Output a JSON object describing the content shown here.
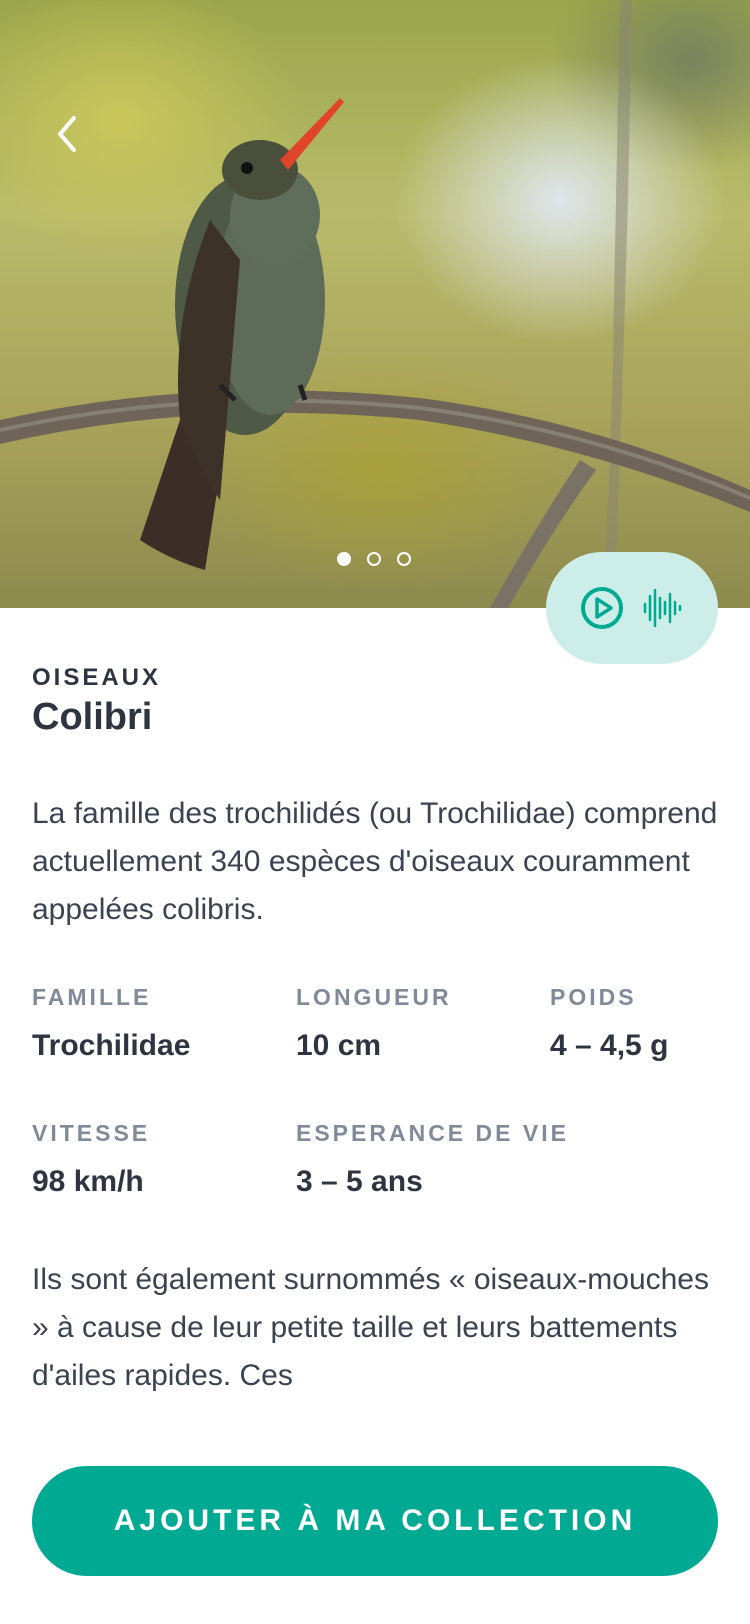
{
  "hero": {
    "photo_subject": "hummingbird-on-branch",
    "dots": [
      true,
      false,
      false
    ]
  },
  "icons": {
    "back": "chevron-left-icon",
    "play": "play-circle-icon",
    "waveform": "sound-wave-icon"
  },
  "bird": {
    "category": "OISEAUX",
    "name": "Colibri",
    "description": "La famille des trochilidés (ou Trochilidae) comprend actuellement 340 espèces d'oiseaux couramment appelées colibris.",
    "stats": [
      {
        "label": "FAMILLE",
        "value": "Trochilidae"
      },
      {
        "label": "LONGUEUR",
        "value": "10 cm"
      },
      {
        "label": "POIDS",
        "value": "4 – 4,5 g"
      },
      {
        "label": "VITESSE",
        "value": "98 km/h"
      },
      {
        "label": "ESPERANCE DE VIE",
        "value": "3 – 5 ans"
      }
    ],
    "more_text": "Ils sont également surnommés « oiseaux-mouches » à cause de leur petite taille et leurs battements d'ailes rapides. Ces"
  },
  "cta": {
    "label": "AJOUTER À MA COLLECTION"
  },
  "colors": {
    "accent": "#00aa92",
    "accent_light": "#cdeee8",
    "text": "#2e3440",
    "muted": "#808a99"
  }
}
